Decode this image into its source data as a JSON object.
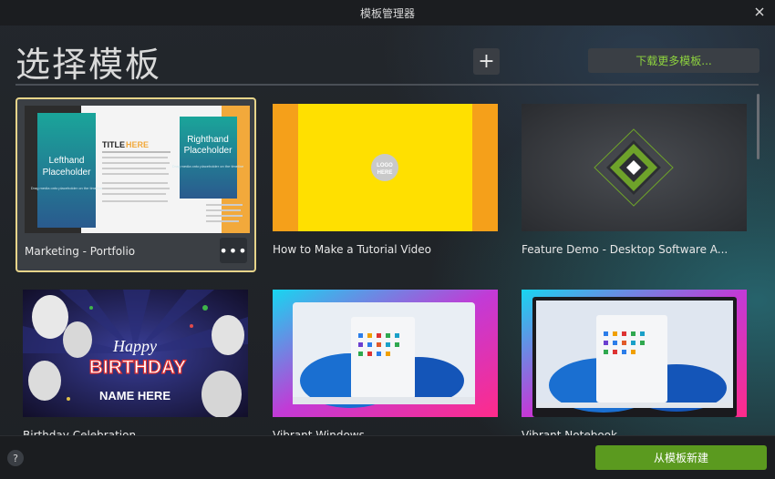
{
  "window": {
    "title": "模板管理器"
  },
  "heading": "选择模板",
  "toolbar": {
    "add_label": "+",
    "download_label": "下载更多模板..."
  },
  "templates": [
    {
      "label": "Marketing - Portfolio",
      "selected": true,
      "thumb": {
        "left_text_1": "Lefthand",
        "left_text_2": "Placeholder",
        "left_small": "Drag media onto placeholder on the timeline",
        "title_prefix": "TITLE",
        "title_accent": "HERE",
        "right_text_1": "Righthand",
        "right_text_2": "Placeholder",
        "right_small": "Drag media onto placeholder on the timeline"
      }
    },
    {
      "label": "How to Make a Tutorial Video",
      "thumb": {
        "logo_1": "LOGO",
        "logo_2": "HERE"
      }
    },
    {
      "label": "Feature Demo - Desktop Software A..."
    },
    {
      "label": "Birthday Celebration",
      "thumb": {
        "happy": "Happy",
        "birthday": "BIRTHDAY",
        "name": "NAME HERE"
      }
    },
    {
      "label": "Vibrant Windows"
    },
    {
      "label": "Vibrant Notebook"
    }
  ],
  "more_label": "•••",
  "footer": {
    "help_label": "?",
    "create_label": "从模板新建"
  },
  "colors": {
    "accent_green": "#8ed33f",
    "primary_button": "#5b9a1f",
    "selection_border": "#e7d48a"
  }
}
